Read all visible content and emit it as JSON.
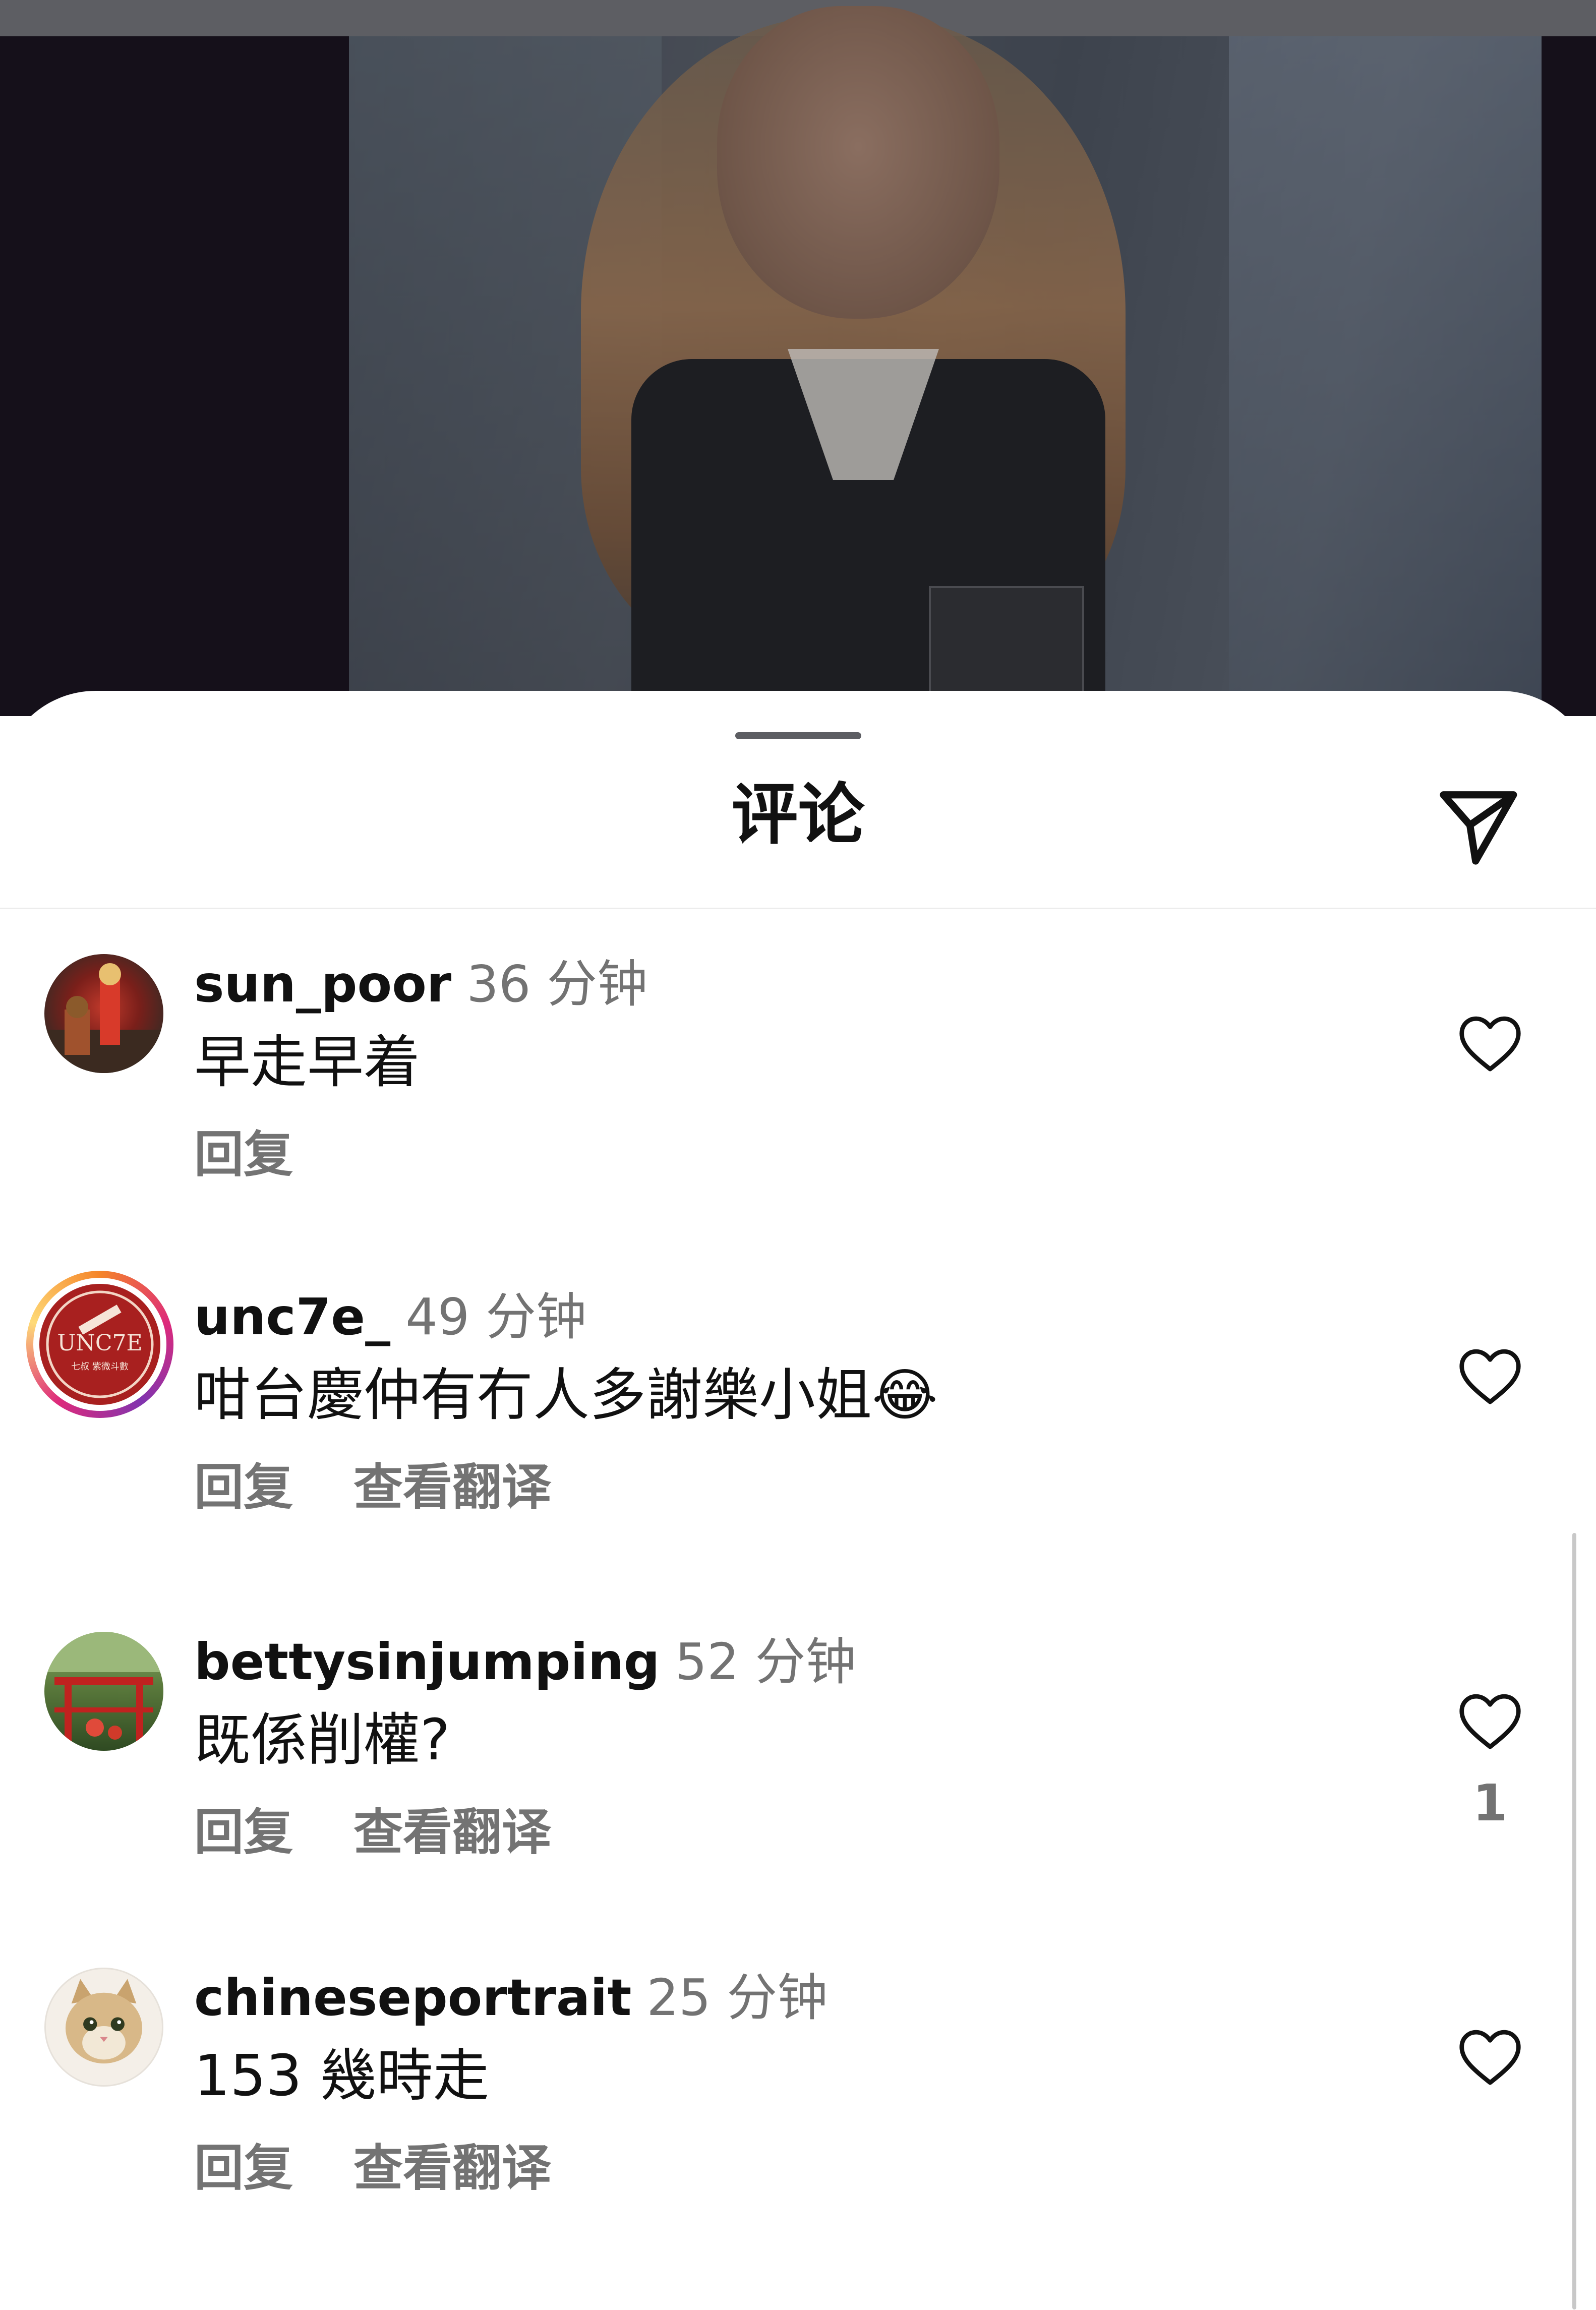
{
  "sheet": {
    "title": "评论"
  },
  "comments": [
    {
      "username": "sun_poor",
      "time": "36 分钟",
      "text": "早走早着",
      "reply": "回复",
      "translate": "",
      "likes": ""
    },
    {
      "username": "unc7e_",
      "time": "49 分钟",
      "text": "咁台慶仲有冇人多謝樂小姐😂",
      "reply": "回复",
      "translate": "查看翻译",
      "likes": "",
      "avatar_text": "UNC7E",
      "avatar_subtext": "七叔 紫微斗數"
    },
    {
      "username": "bettysinjumping",
      "time": "52 分钟",
      "text": "既係削權?",
      "reply": "回复",
      "translate": "查看翻译",
      "likes": "1"
    },
    {
      "username": "chineseportrait",
      "time": "25 分钟",
      "text": "153 幾時走",
      "reply": "回复",
      "translate": "查看翻译",
      "likes": ""
    }
  ],
  "icons": {
    "send": "paper-plane-icon",
    "like": "heart-outline-icon"
  },
  "colors": {
    "text_primary": "#111111",
    "text_secondary": "#737373",
    "background": "#ffffff"
  }
}
